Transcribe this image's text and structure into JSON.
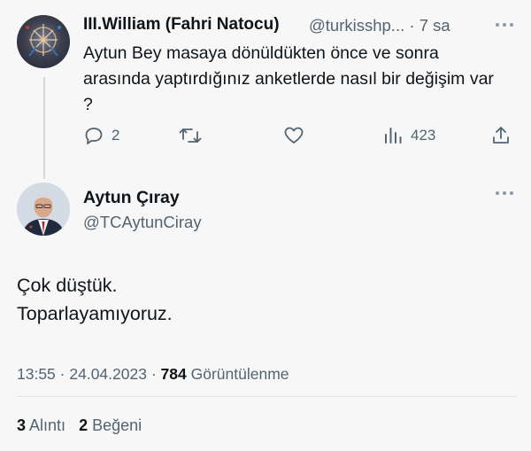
{
  "reply_tweet": {
    "author_name": "III.William (Fahri Natocu)",
    "author_handle": "@turkisshp...",
    "time": "7 sa",
    "separator": "·",
    "text": "Aytun Bey masaya dönüldükten önce ve sonra arasında yaptırdığınız anketlerde nasıl bir değişim var ?",
    "actions": {
      "reply_count": "2",
      "views_count": "423"
    }
  },
  "main_tweet": {
    "author_name": "Aytun Çıray",
    "author_handle": "@TCAytunCiray",
    "text_line1": "Çok düştük.",
    "text_line2": "Toparlayamıyoruz.",
    "time": "13:55",
    "date": "24.04.2023",
    "dot": "·",
    "views_count": "784",
    "views_label": "Görüntülenme",
    "quotes_count": "3",
    "quotes_label": "Alıntı",
    "likes_count": "2",
    "likes_label": "Beğeni"
  },
  "icons": {
    "more": "more-horizontal-icon",
    "reply": "reply-icon",
    "retweet": "retweet-icon",
    "like": "heart-icon",
    "views": "views-bar-icon",
    "share": "share-icon"
  },
  "colors": {
    "background": "#f7f7f7",
    "text": "#0f1419",
    "secondary": "#536471",
    "thread_line": "#cfd9de"
  }
}
